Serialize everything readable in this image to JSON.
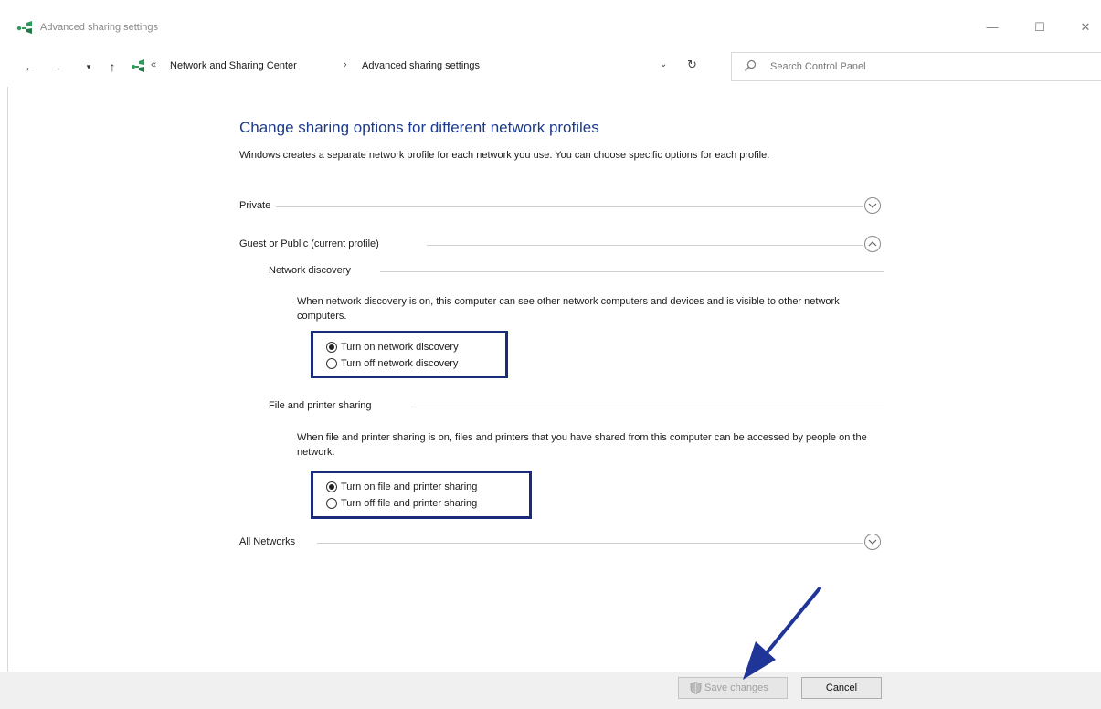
{
  "window": {
    "title": "Advanced sharing settings",
    "controls": {
      "minimize": "—",
      "maximize": "☐",
      "close": "✕"
    }
  },
  "address_bar": {
    "back": "←",
    "forward": "→",
    "recent": "▾",
    "up": "↑",
    "overflow": "«",
    "breadcrumbs": [
      "Network and Sharing Center",
      "Advanced sharing settings"
    ],
    "separator": "›",
    "dropdown": "⌄",
    "refresh": "↻",
    "search_placeholder": "Search Control Panel"
  },
  "main": {
    "heading": "Change sharing options for different network profiles",
    "intro": "Windows creates a separate network profile for each network you use. You can choose specific options for each profile.",
    "profiles": {
      "private": {
        "label": "Private",
        "expanded": false
      },
      "guest_public": {
        "label": "Guest or Public (current profile)",
        "expanded": true
      },
      "all_networks": {
        "label": "All Networks",
        "expanded": false
      }
    },
    "network_discovery": {
      "title": "Network discovery",
      "description": "When network discovery is on, this computer can see other network computers and devices and is visible to other network computers.",
      "options": [
        {
          "label": "Turn on network discovery",
          "checked": true
        },
        {
          "label": "Turn off network discovery",
          "checked": false
        }
      ]
    },
    "file_printer_sharing": {
      "title": "File and printer sharing",
      "description": "When file and printer sharing is on, files and printers that you have shared from this computer can be accessed by people on the network.",
      "options": [
        {
          "label": "Turn on file and printer sharing",
          "checked": true
        },
        {
          "label": "Turn off file and printer sharing",
          "checked": false
        }
      ]
    }
  },
  "footer": {
    "save_label": "Save changes",
    "cancel_label": "Cancel"
  },
  "colors": {
    "heading": "#1e3b8a",
    "highlight_box": "#1b2a7a",
    "annotation_arrow": "#1f3597",
    "network_icon": "#2e9a5a"
  }
}
